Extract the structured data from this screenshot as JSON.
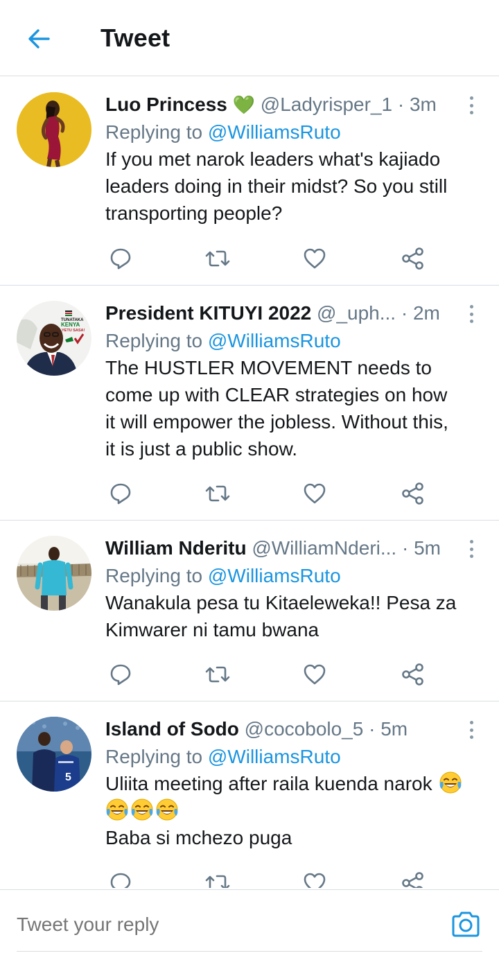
{
  "header": {
    "title": "Tweet",
    "back_icon": "arrow-left-icon"
  },
  "colors": {
    "accent": "#1b95e0",
    "secondary_text": "#657786",
    "divider": "#d9dee2",
    "heart_emoji": "#57b93a"
  },
  "tweets": [
    {
      "name": "Luo Princess",
      "name_emoji": "💚",
      "handle": "@Ladyrisper_1",
      "separator": "·",
      "time": "3m",
      "replying_prefix": "Replying to",
      "replying_to": "@WilliamsRuto",
      "text": "If you met narok leaders what's kajiado\nleaders doing in their midst? So you still\ntransporting people?"
    },
    {
      "name": "President KITUYI 2022",
      "handle": "@_uph...",
      "separator": "·",
      "time": "2m",
      "replying_prefix": "Replying to",
      "replying_to": "@WilliamsRuto",
      "text": "The HUSTLER MOVEMENT needs to\ncome up with CLEAR strategies on how\nit will empower the jobless. Without this,\nit is just a public show.",
      "avatar_text": {
        "line1": "TUNATAKA",
        "line2": "KENYA",
        "line3": "YETU SASA!"
      }
    },
    {
      "name": "William Nderitu",
      "handle": "@WilliamNderi...",
      "separator": "·",
      "time": "5m",
      "replying_prefix": "Replying to",
      "replying_to": "@WilliamsRuto",
      "text": "Wanakula pesa tu Kitaeleweka!! Pesa za\nKimwarer ni tamu bwana"
    },
    {
      "name": "Island of Sodo",
      "handle": "@cocobolo_5",
      "separator": "·",
      "time": "5m",
      "replying_prefix": "Replying to",
      "replying_to": "@WilliamsRuto",
      "text_line1": "Uliita meeting after raila kuenda narok",
      "text_line3": "Baba si mchezo puga",
      "emoji_name": "face-with-tears-of-joy",
      "avatar_text": {
        "jersey": "5"
      }
    }
  ],
  "actions": {
    "reply": "reply-icon",
    "retweet": "retweet-icon",
    "like": "like-icon",
    "share": "share-icon"
  },
  "compose": {
    "placeholder": "Tweet your reply",
    "camera_icon": "camera-icon"
  }
}
